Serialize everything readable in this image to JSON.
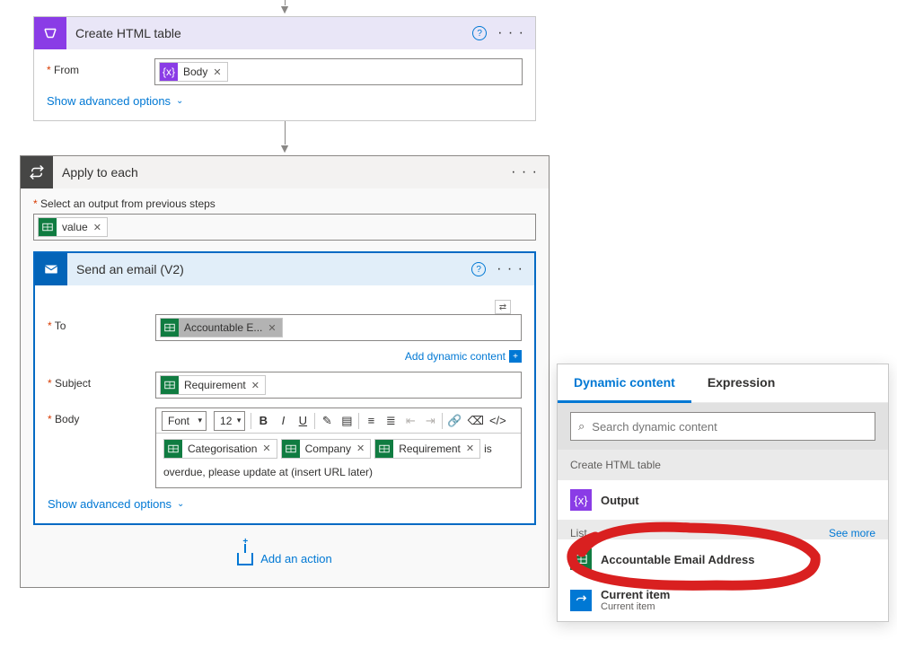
{
  "card1": {
    "title": "Create HTML table",
    "from_label": "From",
    "token_body": "Body",
    "advanced": "Show advanced options"
  },
  "card2": {
    "title": "Apply to each",
    "output_label": "Select an output from previous steps",
    "token_value": "value"
  },
  "emailCard": {
    "title": "Send an email (V2)",
    "to_label": "To",
    "token_to": "Accountable E...",
    "add_dynamic": "Add dynamic content",
    "subject_label": "Subject",
    "token_subject": "Requirement",
    "body_label": "Body",
    "font_label": "Font",
    "font_size": "12",
    "token_cat": "Categorisation",
    "token_company": "Company",
    "token_req": "Requirement",
    "body_text_1": "is",
    "body_text_2": "overdue, please update at (insert URL later)",
    "advanced": "Show advanced options"
  },
  "addAction": "Add an action",
  "dynPanel": {
    "tab_dynamic": "Dynamic content",
    "tab_expression": "Expression",
    "search_placeholder": "Search dynamic content",
    "section1": "Create HTML table",
    "item_output": "Output",
    "section2_prefix": "List",
    "see_more": "See more",
    "item_accountable": "Accountable Email Address",
    "item_current": "Current item",
    "item_current_sub": "Current item"
  }
}
